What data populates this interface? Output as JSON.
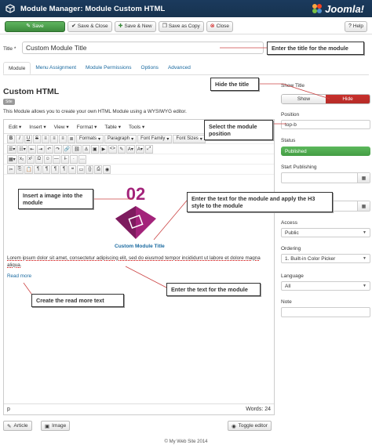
{
  "header": {
    "title": "Module Manager: Module Custom HTML",
    "brand": "Joomla!"
  },
  "toolbar": {
    "save": "Save",
    "save_close": "Save & Close",
    "save_new": "Save & New",
    "save_copy": "Save as Copy",
    "close": "Close",
    "help": "Help"
  },
  "form": {
    "title_label": "Title *",
    "title_value": "Custom Module Title"
  },
  "tabs": [
    "Module",
    "Menu Assignment",
    "Module Permissions",
    "Options",
    "Advanced"
  ],
  "module": {
    "heading": "Custom HTML",
    "badge": "Site",
    "description": "This Module allows you to create your own HTML Module using a WYSIWYG editor."
  },
  "editor": {
    "menus": [
      "Edit",
      "Insert",
      "View",
      "Format",
      "Table",
      "Tools"
    ],
    "formats_label": "Formats",
    "paragraph_label": "Paragraph",
    "font_family_label": "Font Family",
    "font_sizes_label": "Font Sizes",
    "image_number": "02",
    "content_title": "Custom Module Title",
    "lorem": "Lorem ipsum dolor sit amet, consectetur adipiscing elit, sed do eiusmod tempor incididunt ut labore et dolore magna aliqua.",
    "read_more": "Read more",
    "path": "p",
    "word_count": "Words: 24"
  },
  "editor_buttons": {
    "article": "Article",
    "image": "Image",
    "toggle": "Toggle editor"
  },
  "right_panel": {
    "show_title_label": "Show Title",
    "show_option": "Show",
    "hide_option": "Hide",
    "selected_show_title": "Hide",
    "position_label": "Position",
    "position_value": "top-b",
    "status_label": "Status",
    "status_value": "Published",
    "start_publishing_label": "Start Publishing",
    "access_label": "Access",
    "access_value": "Public",
    "ordering_label": "Ordering",
    "ordering_value": "1. Built-in Color Picker",
    "language_label": "Language",
    "language_value": "All",
    "note_label": "Note"
  },
  "callouts": {
    "title": "Enter the title for the module",
    "hide_title": "Hide the title",
    "position": "Select the module position",
    "insert_image": "Insert a image into the module",
    "h3_text": "Enter the text for the module and apply the H3 style to the module",
    "module_text": "Enter the text for the module",
    "read_more": "Create the read more text"
  },
  "footer": "© My Web Site 2014",
  "colors": {
    "header_bg": "#1b3a5d",
    "save_green": "#46a546",
    "hide_red": "#c9302c",
    "published_green": "#5cb85c",
    "link_blue": "#1a6aa0",
    "logo_magenta": "#a3237a"
  }
}
